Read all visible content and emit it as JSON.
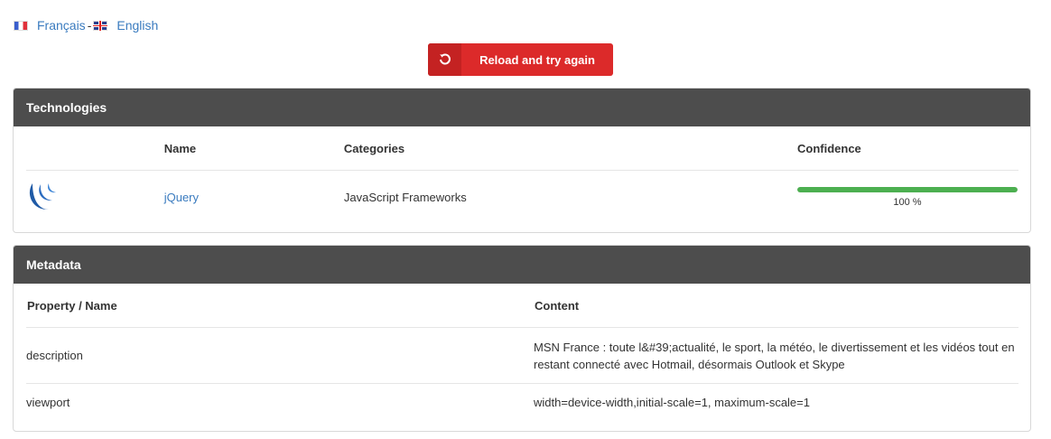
{
  "languages": {
    "french_label": "Français",
    "separator": "-",
    "english_label": "English"
  },
  "reload_button": {
    "icon": "reload-icon",
    "label": "Reload and try again",
    "color": "#dc2a2a"
  },
  "technologies": {
    "title": "Technologies",
    "columns": [
      "Name",
      "Categories",
      "Confidence"
    ],
    "rows": [
      {
        "icon": "jquery-logo-icon",
        "name": "jQuery",
        "category": "JavaScript Frameworks",
        "confidence": 100,
        "confidence_text": "100 %"
      }
    ]
  },
  "metadata": {
    "title": "Metadata",
    "columns": [
      "Property / Name",
      "Content"
    ],
    "rows": [
      {
        "property": "description",
        "content": "MSN France : toute l&#39;actualité, le sport, la météo, le divertissement et les vidéos tout en restant connecté avec Hotmail, désormais Outlook et Skype"
      },
      {
        "property": "viewport",
        "content": "width=device-width,initial-scale=1, maximum-scale=1"
      }
    ]
  },
  "colors": {
    "header_bg": "#4d4d4d",
    "link": "#3a7bbf",
    "confidence_bar": "#4caf50"
  }
}
